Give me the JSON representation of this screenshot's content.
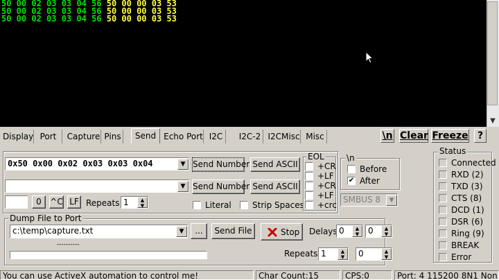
{
  "terminal": {
    "lines": [
      {
        "green": "50 00 02 03 03 04 56",
        "yellow": "50 00 00 03 53"
      },
      {
        "green": "50 00 02 03 03 04 56",
        "yellow": "50 00 00 03 53"
      },
      {
        "green": "50 00 02 03 03 04 56",
        "yellow": "50 00 00 03 53"
      }
    ]
  },
  "tabs": [
    "Display",
    "Port",
    "Capture",
    "Pins",
    "Send",
    "Echo Port",
    "I2C",
    "I2C-2",
    "I2CMisc",
    "Misc"
  ],
  "toolbar": {
    "newline": "\\n",
    "clear": "Clear",
    "freeze": "Freeze",
    "help": "?"
  },
  "send": {
    "line1_value": "0x50 0x00 0x02 0x03 0x03 0x04",
    "line2_value": "",
    "send_numbers_1": "Send Numbers",
    "send_ascii_1": "Send ASCII",
    "send_numbers_2": "Send Numbers",
    "send_ascii_2": "Send ASCII",
    "char_value": "",
    "zero_button": "0",
    "ctrl_c_button": "^C",
    "lf_button": "LF",
    "repeats_label": "Repeats",
    "repeats_value": "1",
    "literal_label": "Literal",
    "strip_spaces_label": "Strip Spaces"
  },
  "eol": {
    "label": "EOL",
    "items": [
      "+CR",
      "+LF",
      "+CR",
      "+LF",
      "+crc"
    ]
  },
  "newline_group": {
    "label": "\\n",
    "before": "Before",
    "after": "After",
    "after_checked": true
  },
  "smbus": {
    "value": "SMBUS 8"
  },
  "dump": {
    "label": "Dump File to Port",
    "path": "c:\\temp\\capture.txt",
    "browse": "...",
    "send_file": "Send File",
    "stop": "Stop",
    "delays_label": "Delays",
    "delay1": "0",
    "delay2": "0",
    "progress_text": "----------",
    "repeats_label": "Repeats",
    "repeats1": "1",
    "repeats2": "0"
  },
  "status_group": {
    "label": "Status",
    "items": [
      "Connected",
      "RXD (2)",
      "TXD (3)",
      "CTS (8)",
      "DCD (1)",
      "DSR (6)",
      "Ring (9)",
      "BREAK",
      "Error"
    ]
  },
  "statusbar": {
    "message": "You can use ActiveX automation to control me!",
    "char_count": "Char Count:15",
    "cps": "CPS:0",
    "port": "Port: 4  115200 8N1 Non"
  },
  "colors": {
    "terminal_bg": "#000000",
    "sent_text": "#00e000",
    "received_text": "#ffff40",
    "stop_icon": "#cc0000"
  }
}
